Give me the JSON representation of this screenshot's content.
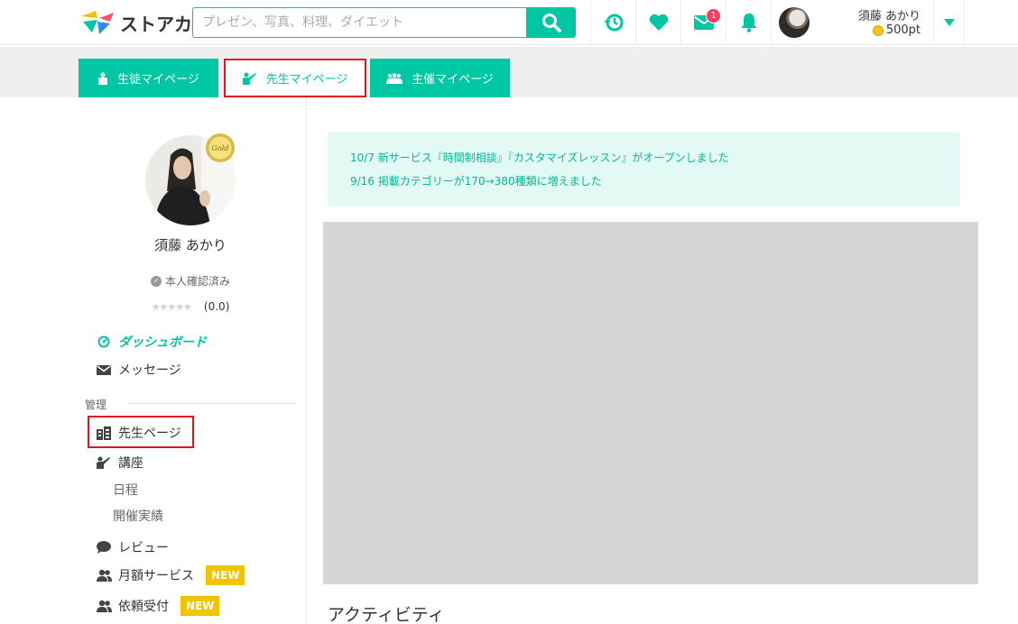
{
  "header": {
    "logo_text": "ストアカ",
    "search_placeholder": "プレゼン、写真、料理、ダイエット",
    "message_badge": "1",
    "user_name": "須藤 あかり",
    "points": "500pt"
  },
  "tabs": [
    {
      "label": "生徒マイページ",
      "icon": "student-icon"
    },
    {
      "label": "先生マイページ",
      "icon": "teacher-icon"
    },
    {
      "label": "主催マイページ",
      "icon": "group-icon"
    }
  ],
  "profile": {
    "badge": "Gold",
    "name": "須藤 あかり",
    "verified": "本人確認済み",
    "rating": "(0.0)"
  },
  "sidebar": {
    "dashboard": "ダッシュボード",
    "message": "メッセージ",
    "section_manage": "管理",
    "teacher_page": "先生ページ",
    "course": "講座",
    "schedule": "日程",
    "history": "開催実績",
    "review": "レビュー",
    "monthly_service": "月額サービス",
    "request": "依頼受付",
    "new_label": "NEW"
  },
  "notices": [
    "10/7 新サービス『時間制相談』『カスタマイズレッスン』がオープンしました",
    "9/16 掲載カテゴリーが170→380種類に増えました"
  ],
  "main": {
    "activity_title": "アクティビティ"
  },
  "colors": {
    "accent": "#00c7a3",
    "highlight": "#e0141e",
    "new_badge": "#f2c400",
    "notice_bg": "#e3f9f4"
  }
}
